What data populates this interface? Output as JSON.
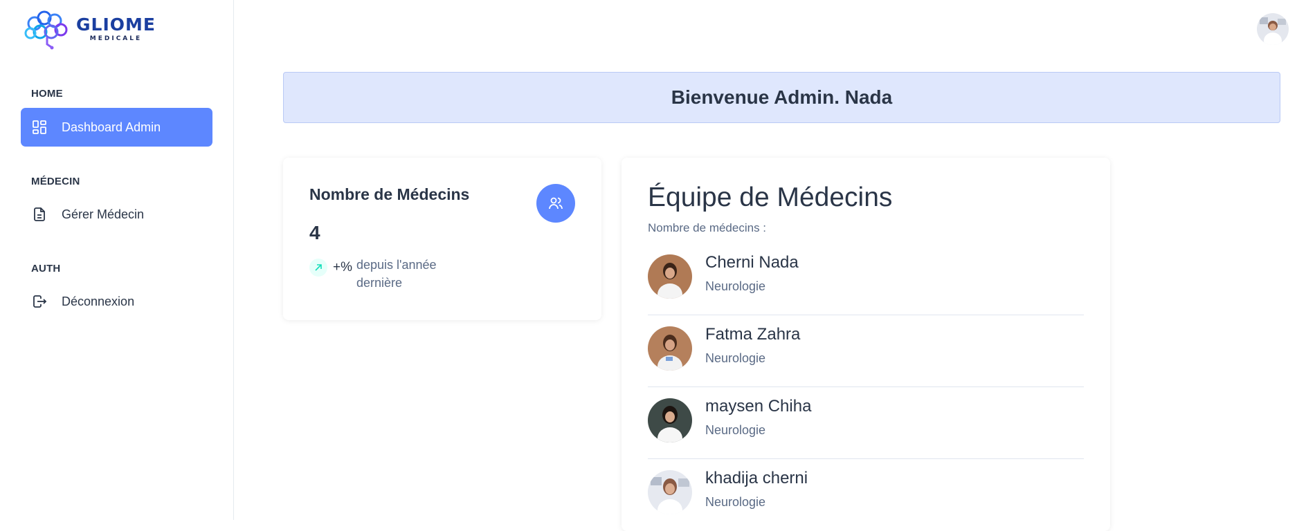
{
  "brand": {
    "title": "GLIOME",
    "subtitle": "MEDICALE"
  },
  "sidebar": {
    "sections": [
      {
        "label": "HOME",
        "items": [
          {
            "label": "Dashboard Admin",
            "icon": "dashboard-icon",
            "active": true
          }
        ]
      },
      {
        "label": "MÉDECIN",
        "items": [
          {
            "label": "Gérer Médecin",
            "icon": "document-icon",
            "active": false
          }
        ]
      },
      {
        "label": "AUTH",
        "items": [
          {
            "label": "Déconnexion",
            "icon": "logout-icon",
            "active": false
          }
        ]
      }
    ]
  },
  "header": {
    "welcome": "Bienvenue Admin. Nada"
  },
  "stats": {
    "title": "Nombre de Médecins",
    "value": "4",
    "trend_pct": "+%",
    "trend_text": "depuis l'année dernière",
    "icon": "users-icon"
  },
  "team": {
    "title": "Équipe de Médecins",
    "subtitle": "Nombre de médecins :",
    "doctors": [
      {
        "name": "Cherni Nada",
        "specialty": "Neurologie"
      },
      {
        "name": "Fatma Zahra",
        "specialty": "Neurologie"
      },
      {
        "name": "maysen Chiha",
        "specialty": "Neurologie"
      },
      {
        "name": "khadija cherni",
        "specialty": "Neurologie"
      }
    ]
  },
  "colors": {
    "primary": "#5d87ff",
    "welcome_bg": "#dfe7fd",
    "text": "#2a3547",
    "muted": "#5a6a85"
  }
}
